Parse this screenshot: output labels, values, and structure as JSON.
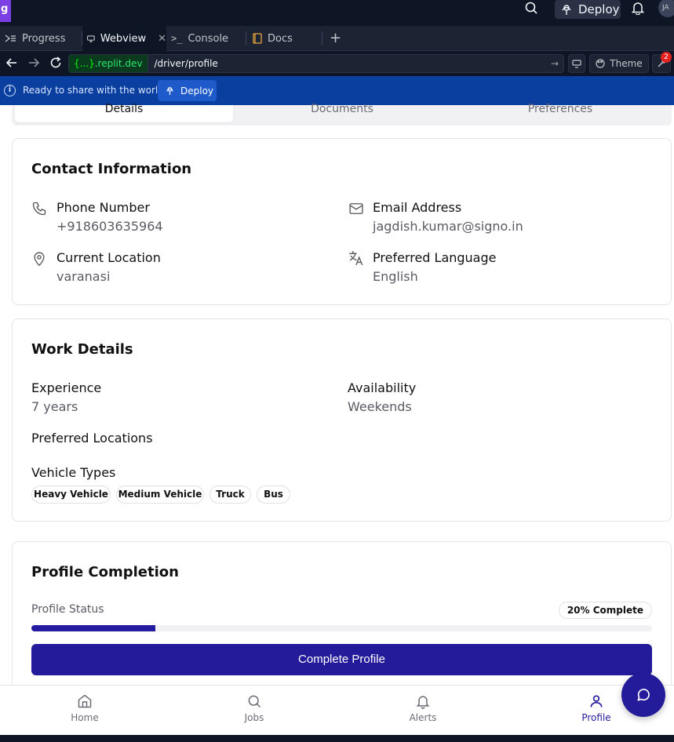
{
  "ide": {
    "logo_letter": "g",
    "deploy_label": "Deploy",
    "avatar_initials": "JA",
    "tabs": [
      {
        "label": "Progress"
      },
      {
        "label": "Webview"
      },
      {
        "label": "Console"
      },
      {
        "label": "Docs"
      }
    ],
    "url_host_brace": "{...}",
    "url_host": ".replit.dev",
    "url_path": "/driver/profile",
    "theme_label": "Theme",
    "notification_count": "2",
    "share_text": "Ready to share with the world?",
    "share_deploy_label": "Deploy"
  },
  "segments": {
    "details": "Details",
    "documents": "Documents",
    "preferences": "Preferences"
  },
  "contact": {
    "title": "Contact Information",
    "phone_label": "Phone Number",
    "phone_value": "+918603635964",
    "email_label": "Email Address",
    "email_value": "jagdish.kumar@signo.in",
    "location_label": "Current Location",
    "location_value": "varanasi",
    "language_label": "Preferred Language",
    "language_value": "English"
  },
  "work": {
    "title": "Work Details",
    "experience_label": "Experience",
    "experience_value": "7 years",
    "availability_label": "Availability",
    "availability_value": "Weekends",
    "preferred_locations_label": "Preferred Locations",
    "vehicle_types_label": "Vehicle Types",
    "vehicle_types": [
      "Heavy Vehicle",
      "Medium Vehicle",
      "Truck",
      "Bus"
    ]
  },
  "completion": {
    "title": "Profile Completion",
    "status_label": "Profile Status",
    "status_pill": "20% Complete",
    "percent": 20,
    "button_label": "Complete Profile"
  },
  "bottom_nav": {
    "home": "Home",
    "jobs": "Jobs",
    "alerts": "Alerts",
    "profile": "Profile"
  },
  "colors": {
    "primary": "#231b9a",
    "ide_bg": "#0e1525",
    "share_bar": "#0a3fa0"
  }
}
